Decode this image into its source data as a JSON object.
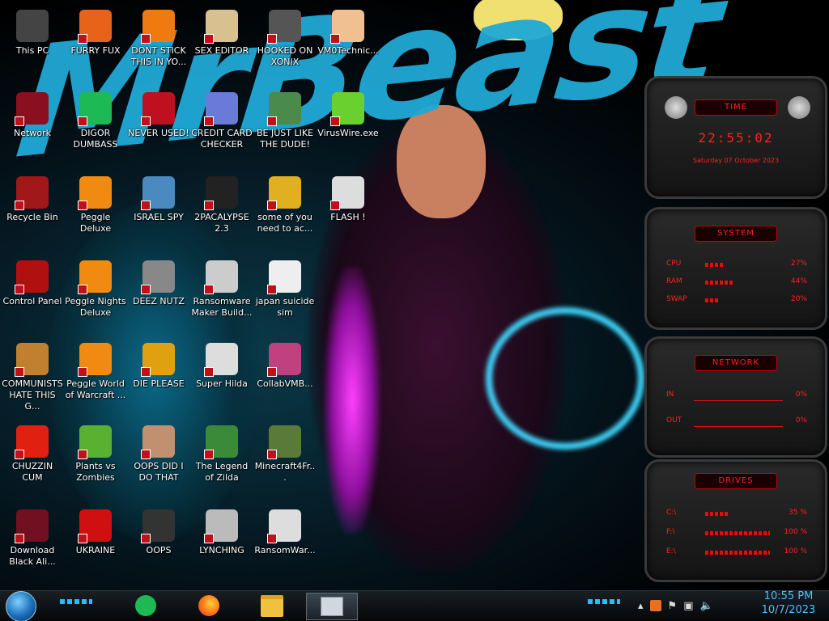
{
  "desktop": {
    "icons": [
      {
        "label": "This PC",
        "color": "#444"
      },
      {
        "label": "FURRY FUX",
        "color": "#e8631a"
      },
      {
        "label": "DONT STICK THIS IN YO...",
        "color": "#f07a10"
      },
      {
        "label": "SEX EDITOR",
        "color": "#d8c090"
      },
      {
        "label": "HOOKED ON XONIX",
        "color": "#555"
      },
      {
        "label": "VM0Technic...",
        "color": "#f0c090"
      },
      {
        "label": "Network",
        "color": "#8a1020"
      },
      {
        "label": "DIGOR DUMBASS",
        "color": "#1db954"
      },
      {
        "label": "NEVER USED!",
        "color": "#c01020"
      },
      {
        "label": "CREDIT CARD CHECKER",
        "color": "#6a7ad8"
      },
      {
        "label": "BE JUST LIKE THE DUDE!",
        "color": "#4a8a4a"
      },
      {
        "label": "VirusWire.exe",
        "color": "#6ad030"
      },
      {
        "label": "Recycle Bin",
        "color": "#a01818"
      },
      {
        "label": "Peggle Deluxe",
        "color": "#f08a10"
      },
      {
        "label": "ISRAEL SPY",
        "color": "#4a8ac0"
      },
      {
        "label": "2PACALYPSE 2.3",
        "color": "#222"
      },
      {
        "label": "some of you need to ac...",
        "color": "#e0b020"
      },
      {
        "label": "FLASH !",
        "color": "#ddd"
      },
      {
        "label": "Control Panel",
        "color": "#b01010"
      },
      {
        "label": "Peggle Nights Deluxe",
        "color": "#f08a10"
      },
      {
        "label": "DEEZ NUTZ",
        "color": "#888"
      },
      {
        "label": "Ransomware Maker Build...",
        "color": "#ccc"
      },
      {
        "label": "japan suicide sim",
        "color": "#eee"
      },
      {
        "label": "COMMUNISTS HATE THIS G...",
        "color": "#c08030"
      },
      {
        "label": "Peggle World of Warcraft ...",
        "color": "#f08a10"
      },
      {
        "label": "DIE PLEASE",
        "color": "#e0a010"
      },
      {
        "label": "Super Hilda",
        "color": "#ddd"
      },
      {
        "label": "CollabVMB...",
        "color": "#c04080"
      },
      {
        "label": "CHUZZIN CUM",
        "color": "#e02010"
      },
      {
        "label": "Plants vs Zombies",
        "color": "#5ab030"
      },
      {
        "label": "OOPS DID I DO THAT",
        "color": "#c09070"
      },
      {
        "label": "The Legend of Zilda",
        "color": "#3a8a3a"
      },
      {
        "label": "Minecraft4Fr...",
        "color": "#5a7a3a"
      },
      {
        "label": "Download Black Ali...",
        "color": "#701020"
      },
      {
        "label": "UKRAINE",
        "color": "#d01010"
      },
      {
        "label": "OOPS",
        "color": "#333"
      },
      {
        "label": "LYNCHING",
        "color": "#bbb"
      },
      {
        "label": "RansomWar...",
        "color": "#ddd"
      }
    ]
  },
  "wallpaper": {
    "text": "MrBeast"
  },
  "gadgets": {
    "time": {
      "title": "TIME",
      "clock": "22:55:02",
      "date": "Saturday 07 October 2023"
    },
    "system": {
      "title": "SYSTEM",
      "rows": [
        {
          "label": "CPU",
          "value": "27%",
          "level": 0.27
        },
        {
          "label": "RAM",
          "value": "44%",
          "level": 0.44
        },
        {
          "label": "SWAP",
          "value": "20%",
          "level": 0.2
        }
      ]
    },
    "network": {
      "title": "NETWORK",
      "rows": [
        {
          "label": "IN",
          "value": "0%"
        },
        {
          "label": "OUT",
          "value": "0%"
        }
      ]
    },
    "drives": {
      "title": "DRIVES",
      "rows": [
        {
          "label": "C:\\",
          "value": "35 %",
          "level": 0.35
        },
        {
          "label": "F:\\",
          "value": "100 %",
          "level": 1.0
        },
        {
          "label": "E:\\",
          "value": "100 %",
          "level": 1.0
        }
      ]
    }
  },
  "taskbar": {
    "apps": [
      "spotify-icon",
      "firefox-icon",
      "file-explorer-icon",
      "collabvm-icon"
    ],
    "clock": {
      "time": "10:55 PM",
      "date": "10/7/2023"
    }
  },
  "colors": {
    "accent": "#1ec0ff",
    "gadget_red": "#ff2020"
  }
}
